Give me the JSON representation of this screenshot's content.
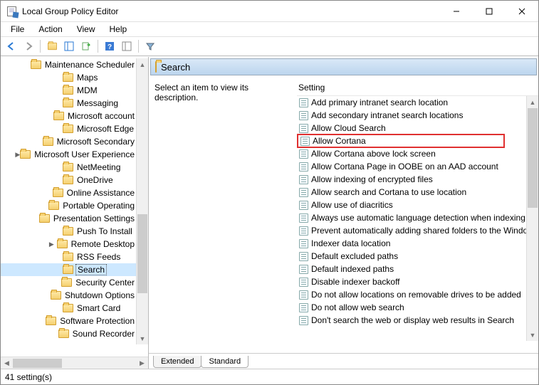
{
  "window": {
    "title": "Local Group Policy Editor"
  },
  "menu": {
    "file": "File",
    "action": "Action",
    "view": "View",
    "help": "Help"
  },
  "tree": {
    "items": [
      {
        "label": "Maintenance Scheduler",
        "expander": " "
      },
      {
        "label": "Maps",
        "expander": " "
      },
      {
        "label": "MDM",
        "expander": " "
      },
      {
        "label": "Messaging",
        "expander": " "
      },
      {
        "label": "Microsoft account",
        "expander": " "
      },
      {
        "label": "Microsoft Edge",
        "expander": " "
      },
      {
        "label": "Microsoft Secondary",
        "expander": " "
      },
      {
        "label": "Microsoft User Experience",
        "expander": ">"
      },
      {
        "label": "NetMeeting",
        "expander": " "
      },
      {
        "label": "OneDrive",
        "expander": " "
      },
      {
        "label": "Online Assistance",
        "expander": " "
      },
      {
        "label": "Portable Operating",
        "expander": " "
      },
      {
        "label": "Presentation Settings",
        "expander": " "
      },
      {
        "label": "Push To Install",
        "expander": " "
      },
      {
        "label": "Remote Desktop",
        "expander": ">"
      },
      {
        "label": "RSS Feeds",
        "expander": " "
      },
      {
        "label": "Search",
        "expander": " ",
        "selected": true
      },
      {
        "label": "Security Center",
        "expander": " "
      },
      {
        "label": "Shutdown Options",
        "expander": " "
      },
      {
        "label": "Smart Card",
        "expander": " "
      },
      {
        "label": "Software Protection",
        "expander": " "
      },
      {
        "label": "Sound Recorder",
        "expander": " "
      }
    ]
  },
  "detail": {
    "header": "Search",
    "description": "Select an item to view its description.",
    "column_label": "Setting",
    "settings": [
      {
        "label": "Add primary intranet search location"
      },
      {
        "label": "Add secondary intranet search locations"
      },
      {
        "label": "Allow Cloud Search"
      },
      {
        "label": "Allow Cortana",
        "highlighted": true
      },
      {
        "label": "Allow Cortana above lock screen"
      },
      {
        "label": "Allow Cortana Page in OOBE on an AAD account"
      },
      {
        "label": "Allow indexing of encrypted files"
      },
      {
        "label": "Allow search and Cortana to use location"
      },
      {
        "label": "Allow use of diacritics"
      },
      {
        "label": "Always use automatic language detection when indexing"
      },
      {
        "label": "Prevent automatically adding shared folders to the Windows"
      },
      {
        "label": "Indexer data location"
      },
      {
        "label": "Default excluded paths"
      },
      {
        "label": "Default indexed paths"
      },
      {
        "label": "Disable indexer backoff"
      },
      {
        "label": "Do not allow locations on removable drives to be added"
      },
      {
        "label": "Do not allow web search"
      },
      {
        "label": "Don't search the web or display web results in Search"
      }
    ]
  },
  "tabs": {
    "extended": "Extended",
    "standard": "Standard"
  },
  "status": "41 setting(s)"
}
